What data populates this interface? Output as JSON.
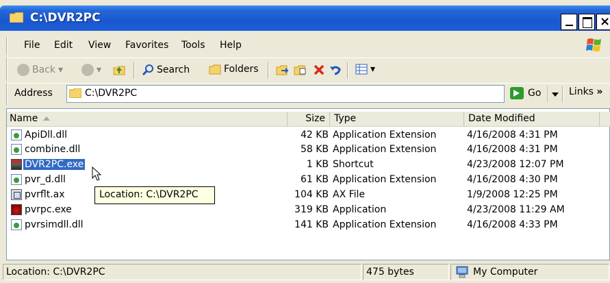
{
  "window": {
    "title": "C:\\DVR2PC",
    "minimize_label": "_",
    "close_label": "×"
  },
  "menu": [
    "File",
    "Edit",
    "View",
    "Favorites",
    "Tools",
    "Help"
  ],
  "toolbar": {
    "back_label": "Back",
    "search_label": "Search",
    "folders_label": "Folders"
  },
  "address": {
    "label": "Address",
    "value": "C:\\DVR2PC",
    "go_label": "Go",
    "links_label": "Links",
    "links_more": "»"
  },
  "columns": {
    "name": "Name",
    "size": "Size",
    "type": "Type",
    "date": "Date Modified"
  },
  "files": [
    {
      "name": "ApiDll.dll",
      "size": "42 KB",
      "type": "Application Extension",
      "date": "4/16/2008 4:31 PM",
      "icon": "dll-icon"
    },
    {
      "name": "combine.dll",
      "size": "58 KB",
      "type": "Application Extension",
      "date": "4/16/2008 4:31 PM",
      "icon": "dll-icon"
    },
    {
      "name": "DVR2PC.exe",
      "size": "1 KB",
      "type": "Shortcut",
      "date": "4/23/2008 12:07 PM",
      "icon": "shortcut-icon",
      "selected": true
    },
    {
      "name": "pvr_d.dll",
      "size": "61 KB",
      "type": "Application Extension",
      "date": "4/16/2008 4:30 PM",
      "icon": "dll-icon"
    },
    {
      "name": "pvrflt.ax",
      "size": "104 KB",
      "type": "AX File",
      "date": "1/9/2008 12:25 PM",
      "icon": "ax-file-icon"
    },
    {
      "name": "pvrpc.exe",
      "size": "319 KB",
      "type": "Application",
      "date": "4/23/2008 11:29 AM",
      "icon": "application-icon"
    },
    {
      "name": "pvrsimdll.dll",
      "size": "141 KB",
      "type": "Application Extension",
      "date": "4/16/2008 4:33 PM",
      "icon": "dll-icon"
    }
  ],
  "tooltip": "Location: C:\\DVR2PC",
  "status": {
    "location": "Location: C:\\DVR2PC",
    "size": "475 bytes",
    "zone": "My Computer"
  },
  "colors": {
    "titlebar": "#1c5fd8",
    "selection": "#316ac5",
    "chrome": "#ece9d8",
    "tooltip_bg": "#ffffe1"
  }
}
